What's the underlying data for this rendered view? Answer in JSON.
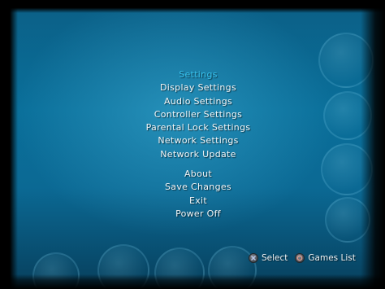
{
  "menu": {
    "title": "Settings",
    "items": [
      "Display Settings",
      "Audio Settings",
      "Controller Settings",
      "Parental Lock Settings",
      "Network Settings",
      "Network Update"
    ],
    "secondary_items": [
      "About",
      "Save Changes",
      "Exit",
      "Power Off"
    ]
  },
  "footer": {
    "select_label": "Select",
    "select_icon": "cross-button-icon",
    "back_label": "Games List",
    "back_icon": "circle-button-icon"
  },
  "colors": {
    "title": "#39c3ee",
    "text": "#f2f6f8",
    "background": "#0a6f9a"
  }
}
